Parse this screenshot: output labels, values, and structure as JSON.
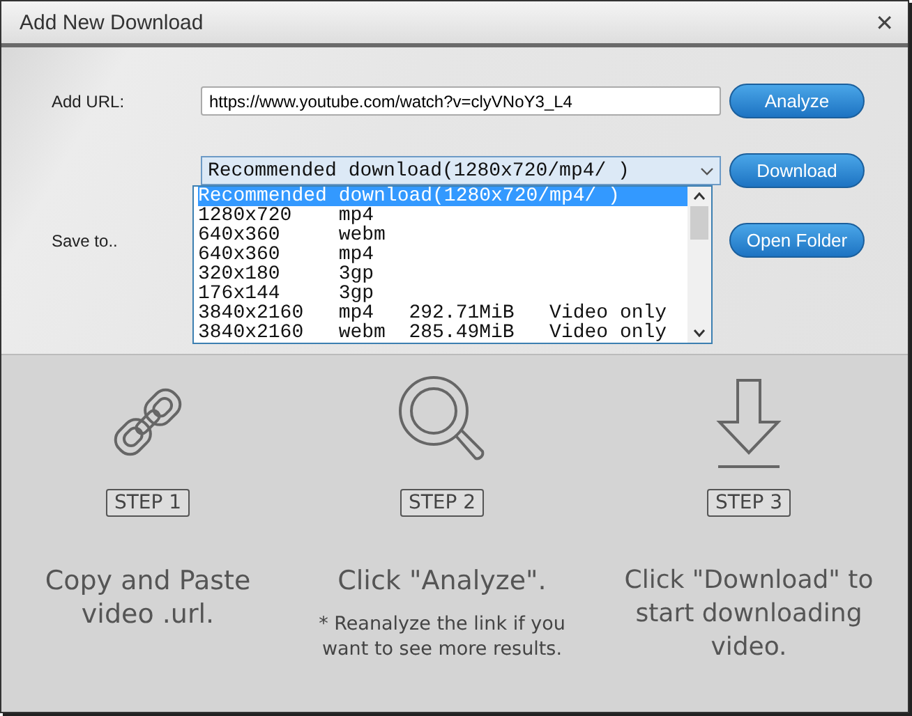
{
  "window": {
    "title": "Add New Download",
    "close": "✕"
  },
  "url_row": {
    "label": "Add URL:",
    "value": "https://www.youtube.com/watch?v=clyVNoY3_L4",
    "button": "Analyze"
  },
  "format_row": {
    "value": "Recommended download(1280x720/mp4/ )",
    "button": "Download",
    "expanded": true,
    "options": [
      {
        "text": "Recommended download(1280x720/mp4/ )",
        "selected": true
      },
      {
        "text": "1280x720    mp4",
        "selected": false
      },
      {
        "text": "640x360     webm",
        "selected": false
      },
      {
        "text": "640x360     mp4",
        "selected": false
      },
      {
        "text": "320x180     3gp",
        "selected": false
      },
      {
        "text": "176x144     3gp",
        "selected": false
      },
      {
        "text": "3840x2160   mp4   292.71MiB   Video only",
        "selected": false
      },
      {
        "text": "3840x2160   webm  285.49MiB   Video only",
        "selected": false
      }
    ]
  },
  "save_row": {
    "label": "Save to..",
    "button": "Open Folder"
  },
  "steps": [
    {
      "kind": "link",
      "label": "STEP 1",
      "text": "Copy and Paste video .url."
    },
    {
      "kind": "search",
      "label": "STEP 2",
      "text": "Click \"Analyze\".",
      "note": "* Reanalyze the link if you want to see more results."
    },
    {
      "kind": "download",
      "label": "STEP 3",
      "text": "Click \"Download\" to start downloading video."
    }
  ]
}
